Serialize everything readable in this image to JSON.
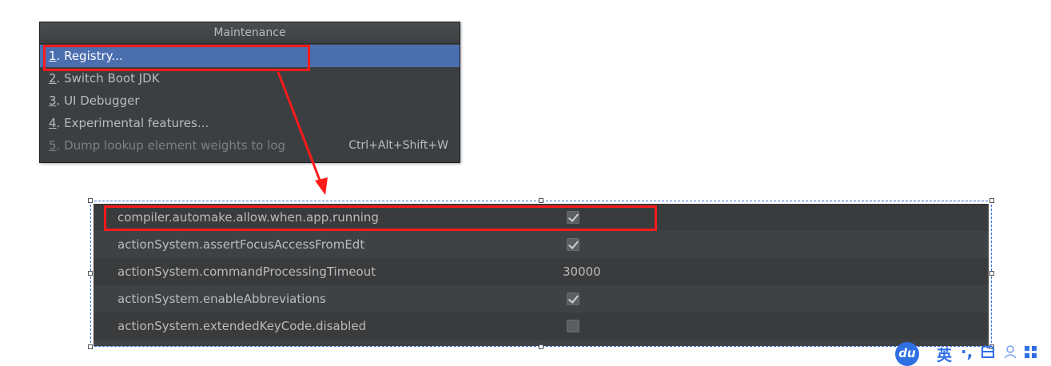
{
  "maintenance_menu": {
    "title": "Maintenance",
    "items": [
      {
        "num": "1",
        "label": ". Registry...",
        "shortcut": "",
        "state": "selected"
      },
      {
        "num": "2",
        "label": ". Switch Boot JDK",
        "shortcut": "",
        "state": "normal"
      },
      {
        "num": "3",
        "label": ". UI Debugger",
        "shortcut": "",
        "state": "normal"
      },
      {
        "num": "4",
        "label": ". Experimental features...",
        "shortcut": "",
        "state": "normal"
      },
      {
        "num": "5",
        "label": ". Dump lookup element weights to log",
        "shortcut": "Ctrl+Alt+Shift+W",
        "state": "disabled"
      }
    ]
  },
  "registry": {
    "rows": [
      {
        "key": "compiler.automake.allow.when.app.running",
        "type": "checkbox",
        "checked": true
      },
      {
        "key": "actionSystem.assertFocusAccessFromEdt",
        "type": "checkbox",
        "checked": true
      },
      {
        "key": "actionSystem.commandProcessingTimeout",
        "type": "text",
        "value": "30000"
      },
      {
        "key": "actionSystem.enableAbbreviations",
        "type": "checkbox",
        "checked": true
      },
      {
        "key": "actionSystem.extendedKeyCode.disabled",
        "type": "checkbox",
        "checked": false
      }
    ]
  },
  "ime_bar": {
    "logo": "du",
    "mode": "英",
    "punct": "·,",
    "skin_icon": "shirt-icon",
    "user_icon": "user-icon",
    "grid_icon": "grid-icon"
  },
  "colors": {
    "highlight_red": "#ff1a1a",
    "menu_selected": "#4b6eaf",
    "dark_bg": "#3c3f41"
  }
}
